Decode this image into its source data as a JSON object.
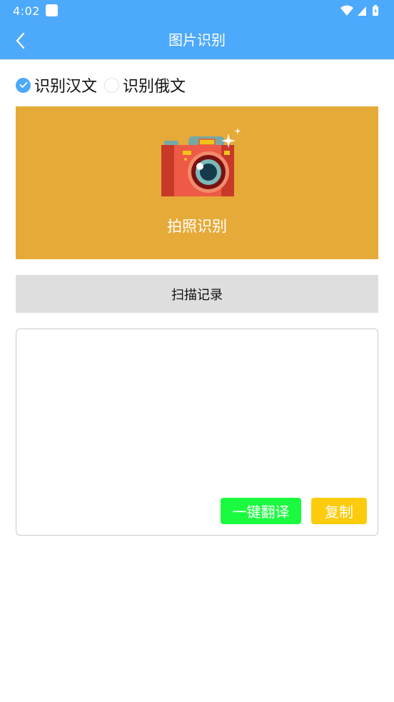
{
  "status_bar": {
    "time": "4:02",
    "icons": [
      "app-notification-icon",
      "wifi-icon",
      "cellular-signal-icon",
      "battery-icon"
    ]
  },
  "app_bar": {
    "title": "图片识别",
    "back_icon": "chevron-left-icon"
  },
  "language_options": [
    {
      "label": "识别汉文",
      "checked": true
    },
    {
      "label": "识别俄文",
      "checked": false
    }
  ],
  "photo_panel": {
    "label": "拍照识别",
    "icon": "camera-icon"
  },
  "scan_record": {
    "label": "扫描记录"
  },
  "text_area": {
    "value": ""
  },
  "actions": {
    "translate_label": "一键翻译",
    "copy_label": "复制"
  },
  "colors": {
    "primary": "#4da9fb",
    "photo_panel_bg": "#e6aa38",
    "scan_button_bg": "#dedede",
    "translate_button_bg": "#1afb3f",
    "copy_button_bg": "#fbcb0c"
  }
}
